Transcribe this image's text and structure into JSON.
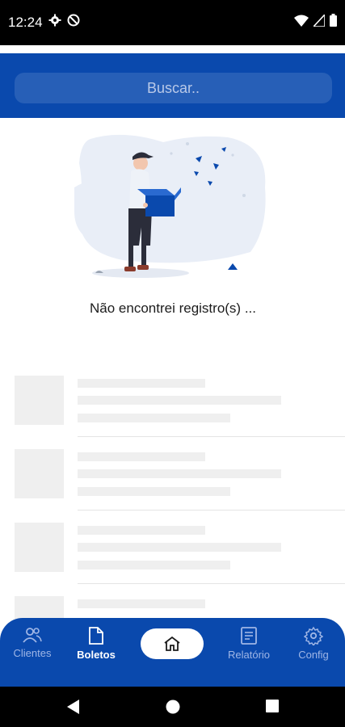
{
  "status_bar": {
    "time": "12:24"
  },
  "search": {
    "placeholder": "Buscar.."
  },
  "empty_state": {
    "message": "Não encontrei registro(s) ..."
  },
  "skeleton_rows": 4,
  "bottom_nav": {
    "items": [
      {
        "label": "Clientes",
        "icon": "users-icon",
        "active": false
      },
      {
        "label": "Boletos",
        "icon": "document-icon",
        "active": true
      },
      {
        "label": "",
        "icon": "home-icon",
        "active": false
      },
      {
        "label": "Relatório",
        "icon": "report-icon",
        "active": false
      },
      {
        "label": "Config",
        "icon": "gear-icon",
        "active": false
      }
    ]
  },
  "colors": {
    "primary": "#0a49ad",
    "inactive_nav": "#9fb6e6",
    "skeleton": "#efefef"
  }
}
